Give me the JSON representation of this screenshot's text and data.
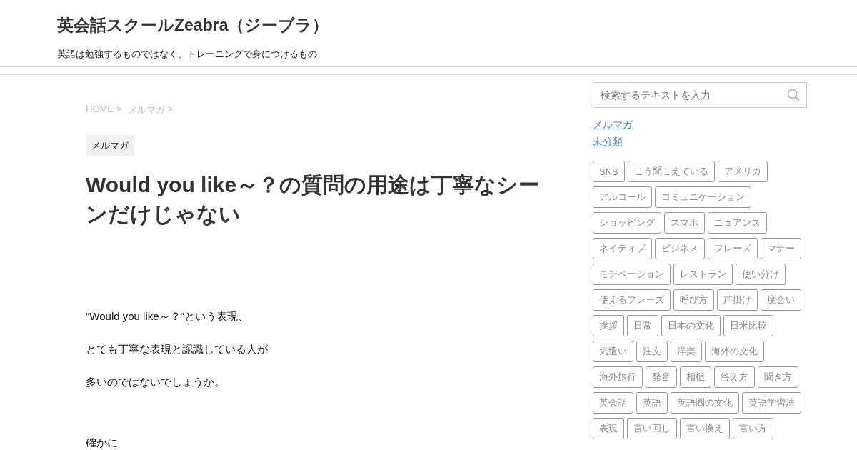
{
  "site": {
    "title": "英会話スクールZeabra（ジーブラ）",
    "tagline": "英語は勉強するものではなく、トレーニングで身につけるもの"
  },
  "breadcrumb": {
    "items": [
      "HOME",
      "メルマガ"
    ],
    "separator": ">"
  },
  "category_label": "メルマガ",
  "article": {
    "title": "Would you like～？の質問の用途は丁寧なシーンだけじゃない",
    "paragraphs": [
      "\"Would you like～？\"という表現、",
      "とても丁寧な表現と認識している人が",
      "多いのではないでしょうか。"
    ],
    "cut_paragraph": "確かに"
  },
  "sidebar": {
    "search": {
      "placeholder": "検索するテキストを入力"
    },
    "categories": [
      "メルマガ",
      "未分類"
    ],
    "tags": [
      "SNS",
      "こう聞こえている",
      "アメリカ",
      "アルコール",
      "コミュニケーション",
      "ショッピング",
      "スマホ",
      "ニュアンス",
      "ネイティブ",
      "ビジネス",
      "フレーズ",
      "マナー",
      "モチベーション",
      "レストラン",
      "使い分け",
      "使えるフレーズ",
      "呼び方",
      "声掛け",
      "度合い",
      "挨拶",
      "日常",
      "日本の文化",
      "日米比較",
      "気遣い",
      "注文",
      "洋楽",
      "海外の文化",
      "海外旅行",
      "発音",
      "相槌",
      "答え方",
      "聞き方",
      "英会話",
      "英語",
      "英語圏の文化",
      "英語学習法",
      "表現",
      "言い回し",
      "言い換え",
      "言い方"
    ]
  }
}
